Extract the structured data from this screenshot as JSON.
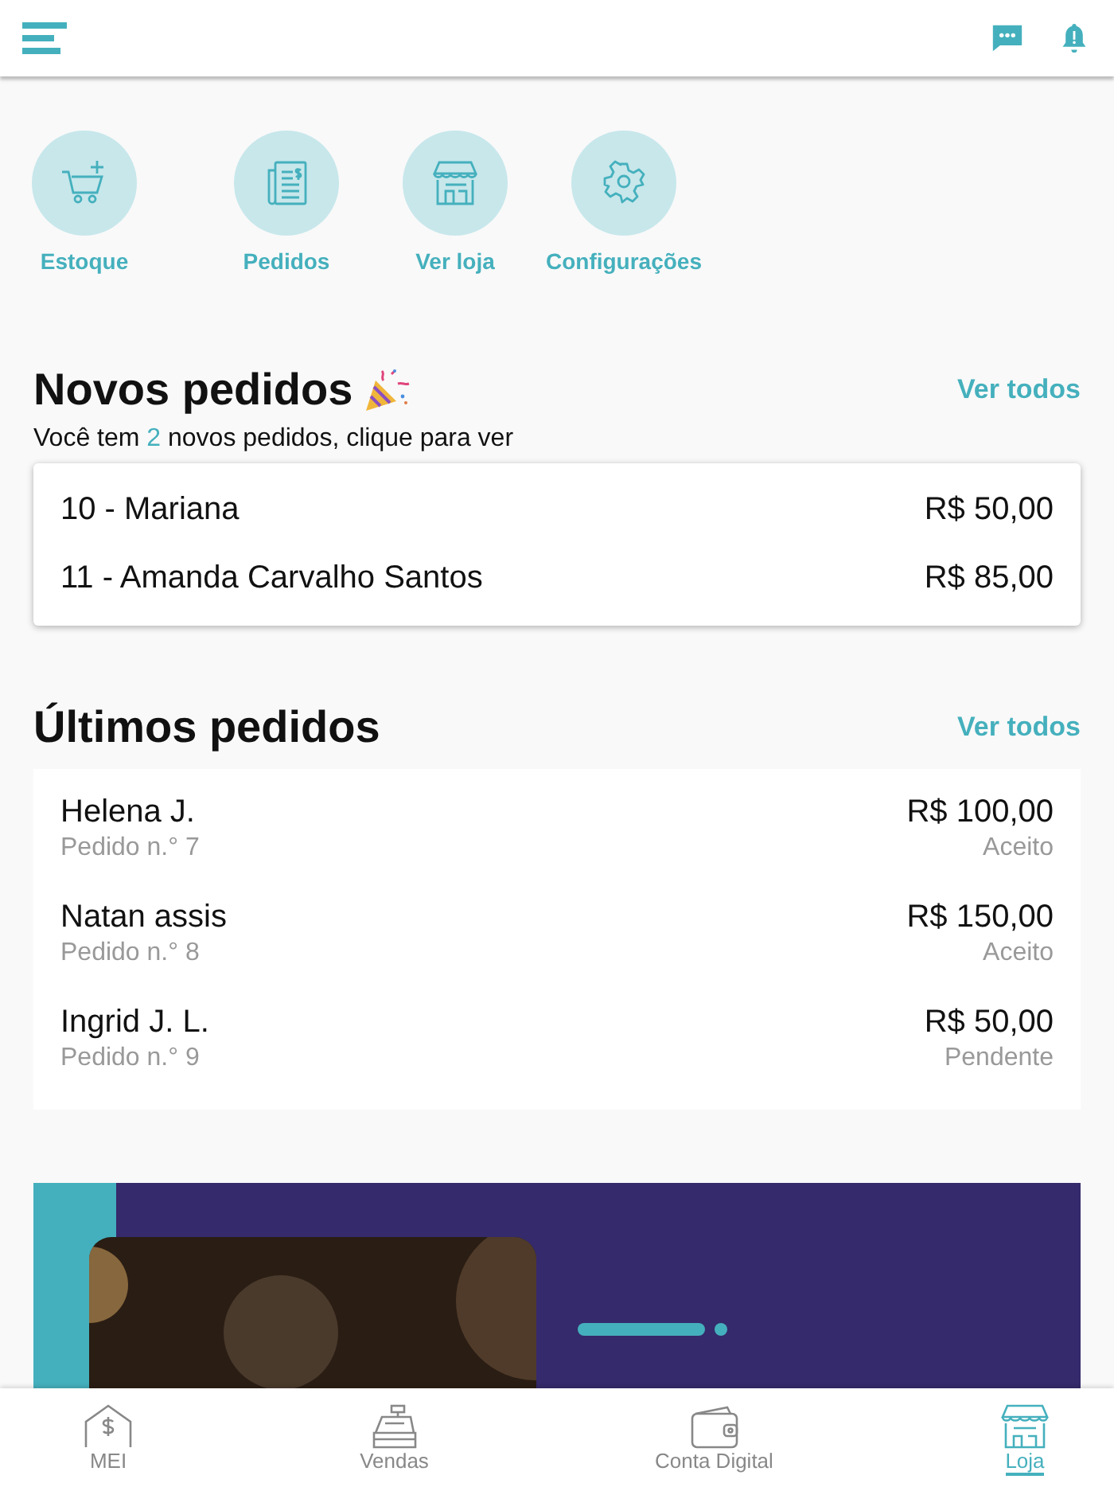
{
  "shortcuts": [
    {
      "kind": "cart",
      "label": "Estoque"
    },
    {
      "kind": "receipt",
      "label": "Pedidos"
    },
    {
      "kind": "store",
      "label": "Ver loja"
    },
    {
      "kind": "gear",
      "label": "Configurações"
    }
  ],
  "new_orders": {
    "title": "Novos pedidos",
    "see_all": "Ver todos",
    "subtitle_before": "Você tem ",
    "count": "2",
    "subtitle_after": " novos pedidos, clique para ver",
    "rows": [
      {
        "name": "10 - Mariana",
        "amount": "R$ 50,00"
      },
      {
        "name": "11 - Amanda Carvalho Santos",
        "amount": "R$ 85,00"
      }
    ]
  },
  "latest_orders": {
    "title": "Últimos pedidos",
    "see_all": "Ver todos",
    "rows": [
      {
        "name": "Helena J.",
        "number": "Pedido n.° 7",
        "amount": "R$ 100,00",
        "status": "Aceito"
      },
      {
        "name": "Natan assis",
        "number": "Pedido n.° 8",
        "amount": "R$ 150,00",
        "status": "Aceito"
      },
      {
        "name": "Ingrid J. L.",
        "number": "Pedido n.° 9",
        "amount": "R$ 50,00",
        "status": "Pendente"
      }
    ]
  },
  "bottom_nav": [
    {
      "kind": "house",
      "label": "MEI",
      "selected": false
    },
    {
      "kind": "register",
      "label": "Vendas",
      "selected": false
    },
    {
      "kind": "wallet",
      "label": "Conta Digital",
      "selected": false
    },
    {
      "kind": "store",
      "label": "Loja",
      "selected": true
    }
  ]
}
